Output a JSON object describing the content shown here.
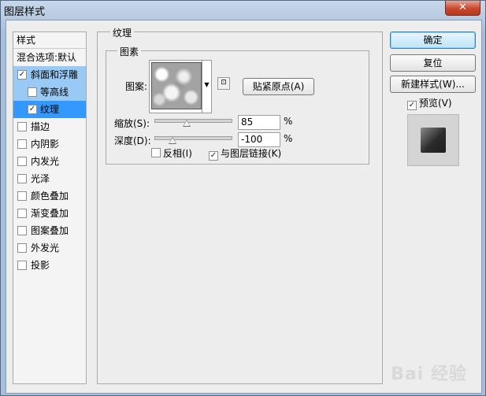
{
  "window": {
    "title": "图层样式",
    "close_glyph": "✕"
  },
  "styles": {
    "header": "样式",
    "blend_options": "混合选项:默认",
    "items": [
      {
        "label": "斜面和浮雕",
        "checked": true
      },
      {
        "label": "等高线",
        "checked": false
      },
      {
        "label": "纹理",
        "checked": true
      },
      {
        "label": "描边",
        "checked": false
      },
      {
        "label": "内阴影",
        "checked": false
      },
      {
        "label": "内发光",
        "checked": false
      },
      {
        "label": "光泽",
        "checked": false
      },
      {
        "label": "颜色叠加",
        "checked": false
      },
      {
        "label": "渐变叠加",
        "checked": false
      },
      {
        "label": "图案叠加",
        "checked": false
      },
      {
        "label": "外发光",
        "checked": false
      },
      {
        "label": "投影",
        "checked": false
      }
    ]
  },
  "texture": {
    "section_title": "纹理",
    "group_title": "图素",
    "pattern_label": "图案:",
    "snap_button": "贴紧原点(A)",
    "scale_label": "缩放(S):",
    "scale_value": "85",
    "scale_unit": "%",
    "scale_percent": 85,
    "depth_label": "深度(D):",
    "depth_value": "-100",
    "depth_unit": "%",
    "depth_value_number": -100,
    "invert_label": "反相(I)",
    "invert_checked": false,
    "link_label": "与图层链接(K)",
    "link_checked": true
  },
  "actions": {
    "ok": "确定",
    "reset": "复位",
    "new_style": "新建样式(W)...",
    "preview_label": "预览(V)",
    "preview_checked": true
  },
  "watermark": "Bai 经验"
}
